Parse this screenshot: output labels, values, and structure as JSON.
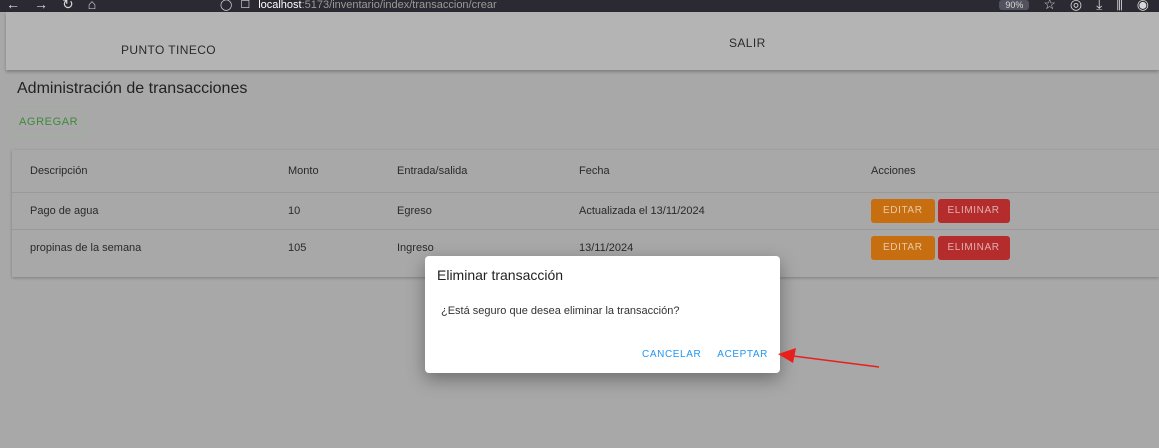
{
  "browser": {
    "url_host": "localhost",
    "url_path": ":5173/inventario/index/transaccion/crear",
    "zoom": "90%"
  },
  "appbar": {
    "brand": "PUNTO TINECO",
    "logout": "SALIR"
  },
  "page": {
    "title": "Administración de transacciones",
    "add_label": "AGREGAR"
  },
  "table": {
    "headers": [
      "Descripción",
      "Monto",
      "Entrada/salida",
      "Fecha",
      "Acciones"
    ],
    "rows": [
      {
        "descripcion": "Pago de agua",
        "monto": "10",
        "tipo": "Egreso",
        "fecha": "Actualizada el 13/11/2024"
      },
      {
        "descripcion": "propinas de la semana",
        "monto": "105",
        "tipo": "Ingreso",
        "fecha": "13/11/2024"
      }
    ],
    "edit_label": "EDITAR",
    "delete_label": "ELIMINAR"
  },
  "dialog": {
    "title": "Eliminar transacción",
    "message": "¿Está seguro que desea eliminar la transacción?",
    "cancel_label": "CANCELAR",
    "accept_label": "ACEPTAR"
  },
  "colors": {
    "accent": "#2196f3",
    "edit": "#c76f10",
    "delete": "#b52c2c",
    "annotation_arrow": "#e8201c"
  }
}
